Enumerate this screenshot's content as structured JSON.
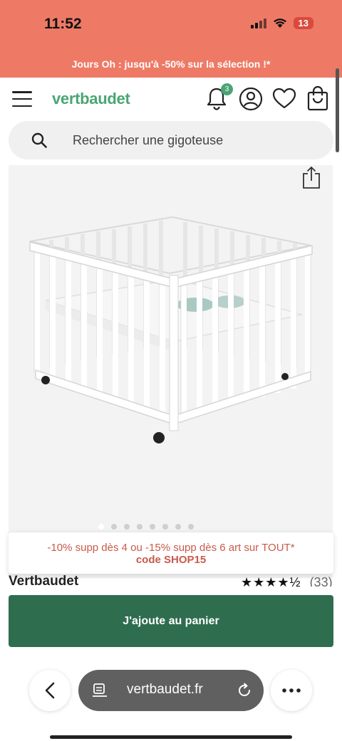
{
  "status_bar": {
    "time": "11:52",
    "battery": "13"
  },
  "promo_banner": {
    "text": "Jours Oh : jusqu'à -50% sur la sélection !*"
  },
  "header": {
    "logo": "vertbaudet",
    "notification_count": "3"
  },
  "search": {
    "placeholder": "Rechercher une gigoteuse"
  },
  "promo_card": {
    "line1": "-10% supp dès 4 ou -15% supp dès 6 art sur TOUT*",
    "line2": "code SHOP15"
  },
  "product": {
    "brand": "Vertbaudet",
    "stars": "★★★★½",
    "review_count": "(33)",
    "image_count": 8,
    "active_image_index": 0
  },
  "cart": {
    "label": "J'ajoute au panier"
  },
  "browser": {
    "url": "vertbaudet.fr"
  },
  "colors": {
    "banner": "#ee7a66",
    "brand_green": "#4aa574",
    "cart_button": "#2f6d4f",
    "promo_text": "#c85a4a"
  },
  "icons": [
    "menu-icon",
    "bell-icon",
    "account-icon",
    "heart-icon",
    "bag-icon",
    "search-icon",
    "share-icon",
    "back-icon",
    "reader-icon",
    "reload-icon",
    "more-icon"
  ]
}
